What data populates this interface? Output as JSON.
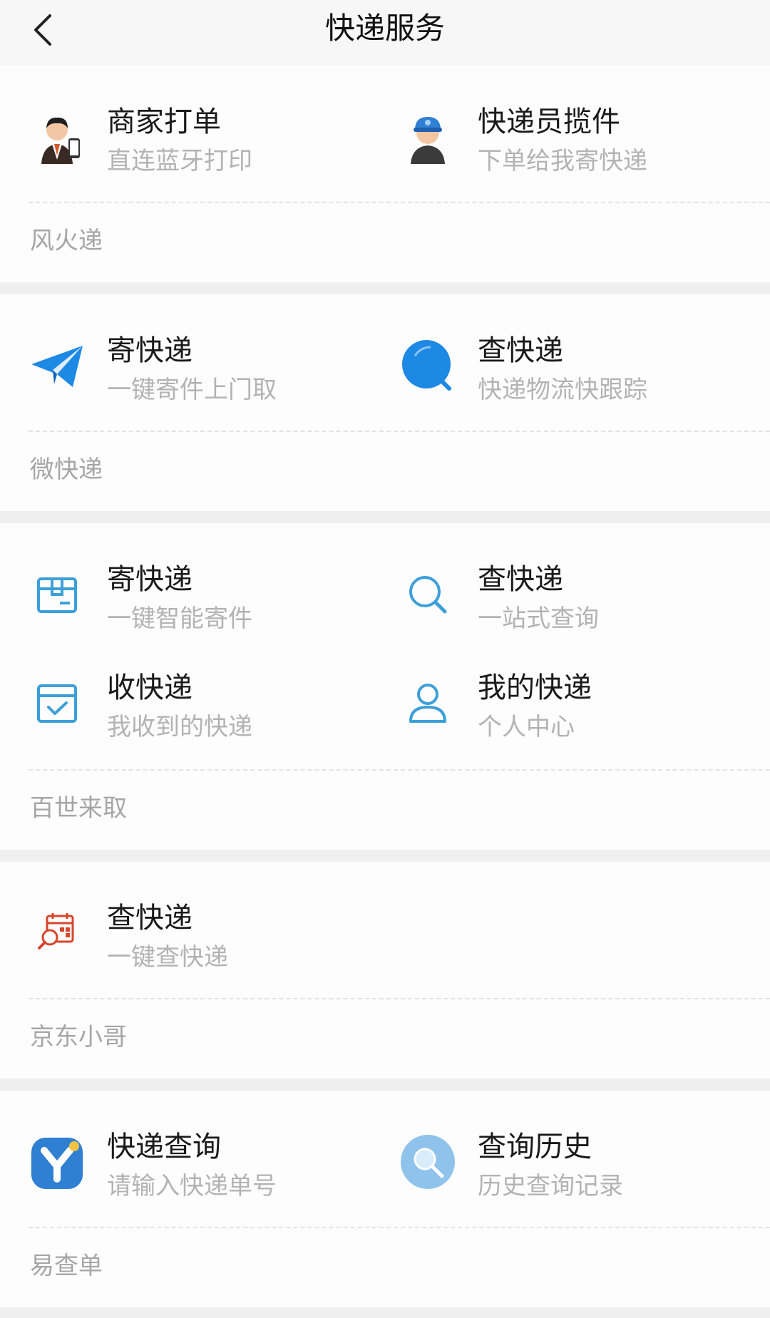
{
  "header": {
    "title": "快递服务",
    "back_icon": "chevron-left-icon"
  },
  "sections": [
    {
      "source": "风火递",
      "items": [
        {
          "label": "商家打单",
          "sub": "直连蓝牙打印",
          "icon": "merchant-avatar-icon"
        },
        {
          "label": "快递员揽件",
          "sub": "下单给我寄快递",
          "icon": "courier-avatar-icon"
        }
      ]
    },
    {
      "source": "微快递",
      "items": [
        {
          "label": "寄快递",
          "sub": "一键寄件上门取",
          "icon": "paper-plane-icon"
        },
        {
          "label": "查快递",
          "sub": "快递物流快跟踪",
          "icon": "search-bubble-icon"
        }
      ]
    },
    {
      "source": "百世来取",
      "items": [
        {
          "label": "寄快递",
          "sub": "一键智能寄件",
          "icon": "package-box-icon"
        },
        {
          "label": "查快递",
          "sub": "一站式查询",
          "icon": "magnifier-icon"
        },
        {
          "label": "收快递",
          "sub": "我收到的快递",
          "icon": "received-box-icon"
        },
        {
          "label": "我的快递",
          "sub": "个人中心",
          "icon": "user-icon"
        }
      ]
    },
    {
      "source": "京东小哥",
      "items": [
        {
          "label": "查快递",
          "sub": "一键查快递",
          "icon": "calendar-search-icon"
        }
      ]
    },
    {
      "source": "易查单",
      "items": [
        {
          "label": "快递查询",
          "sub": "请输入快递单号",
          "icon": "y-logo-icon"
        },
        {
          "label": "查询历史",
          "sub": "历史查询记录",
          "icon": "history-magnifier-icon"
        }
      ]
    }
  ],
  "colors": {
    "accent_blue": "#1e88e5",
    "icon_blue": "#3d9fd9",
    "icon_red": "#d9452b"
  }
}
